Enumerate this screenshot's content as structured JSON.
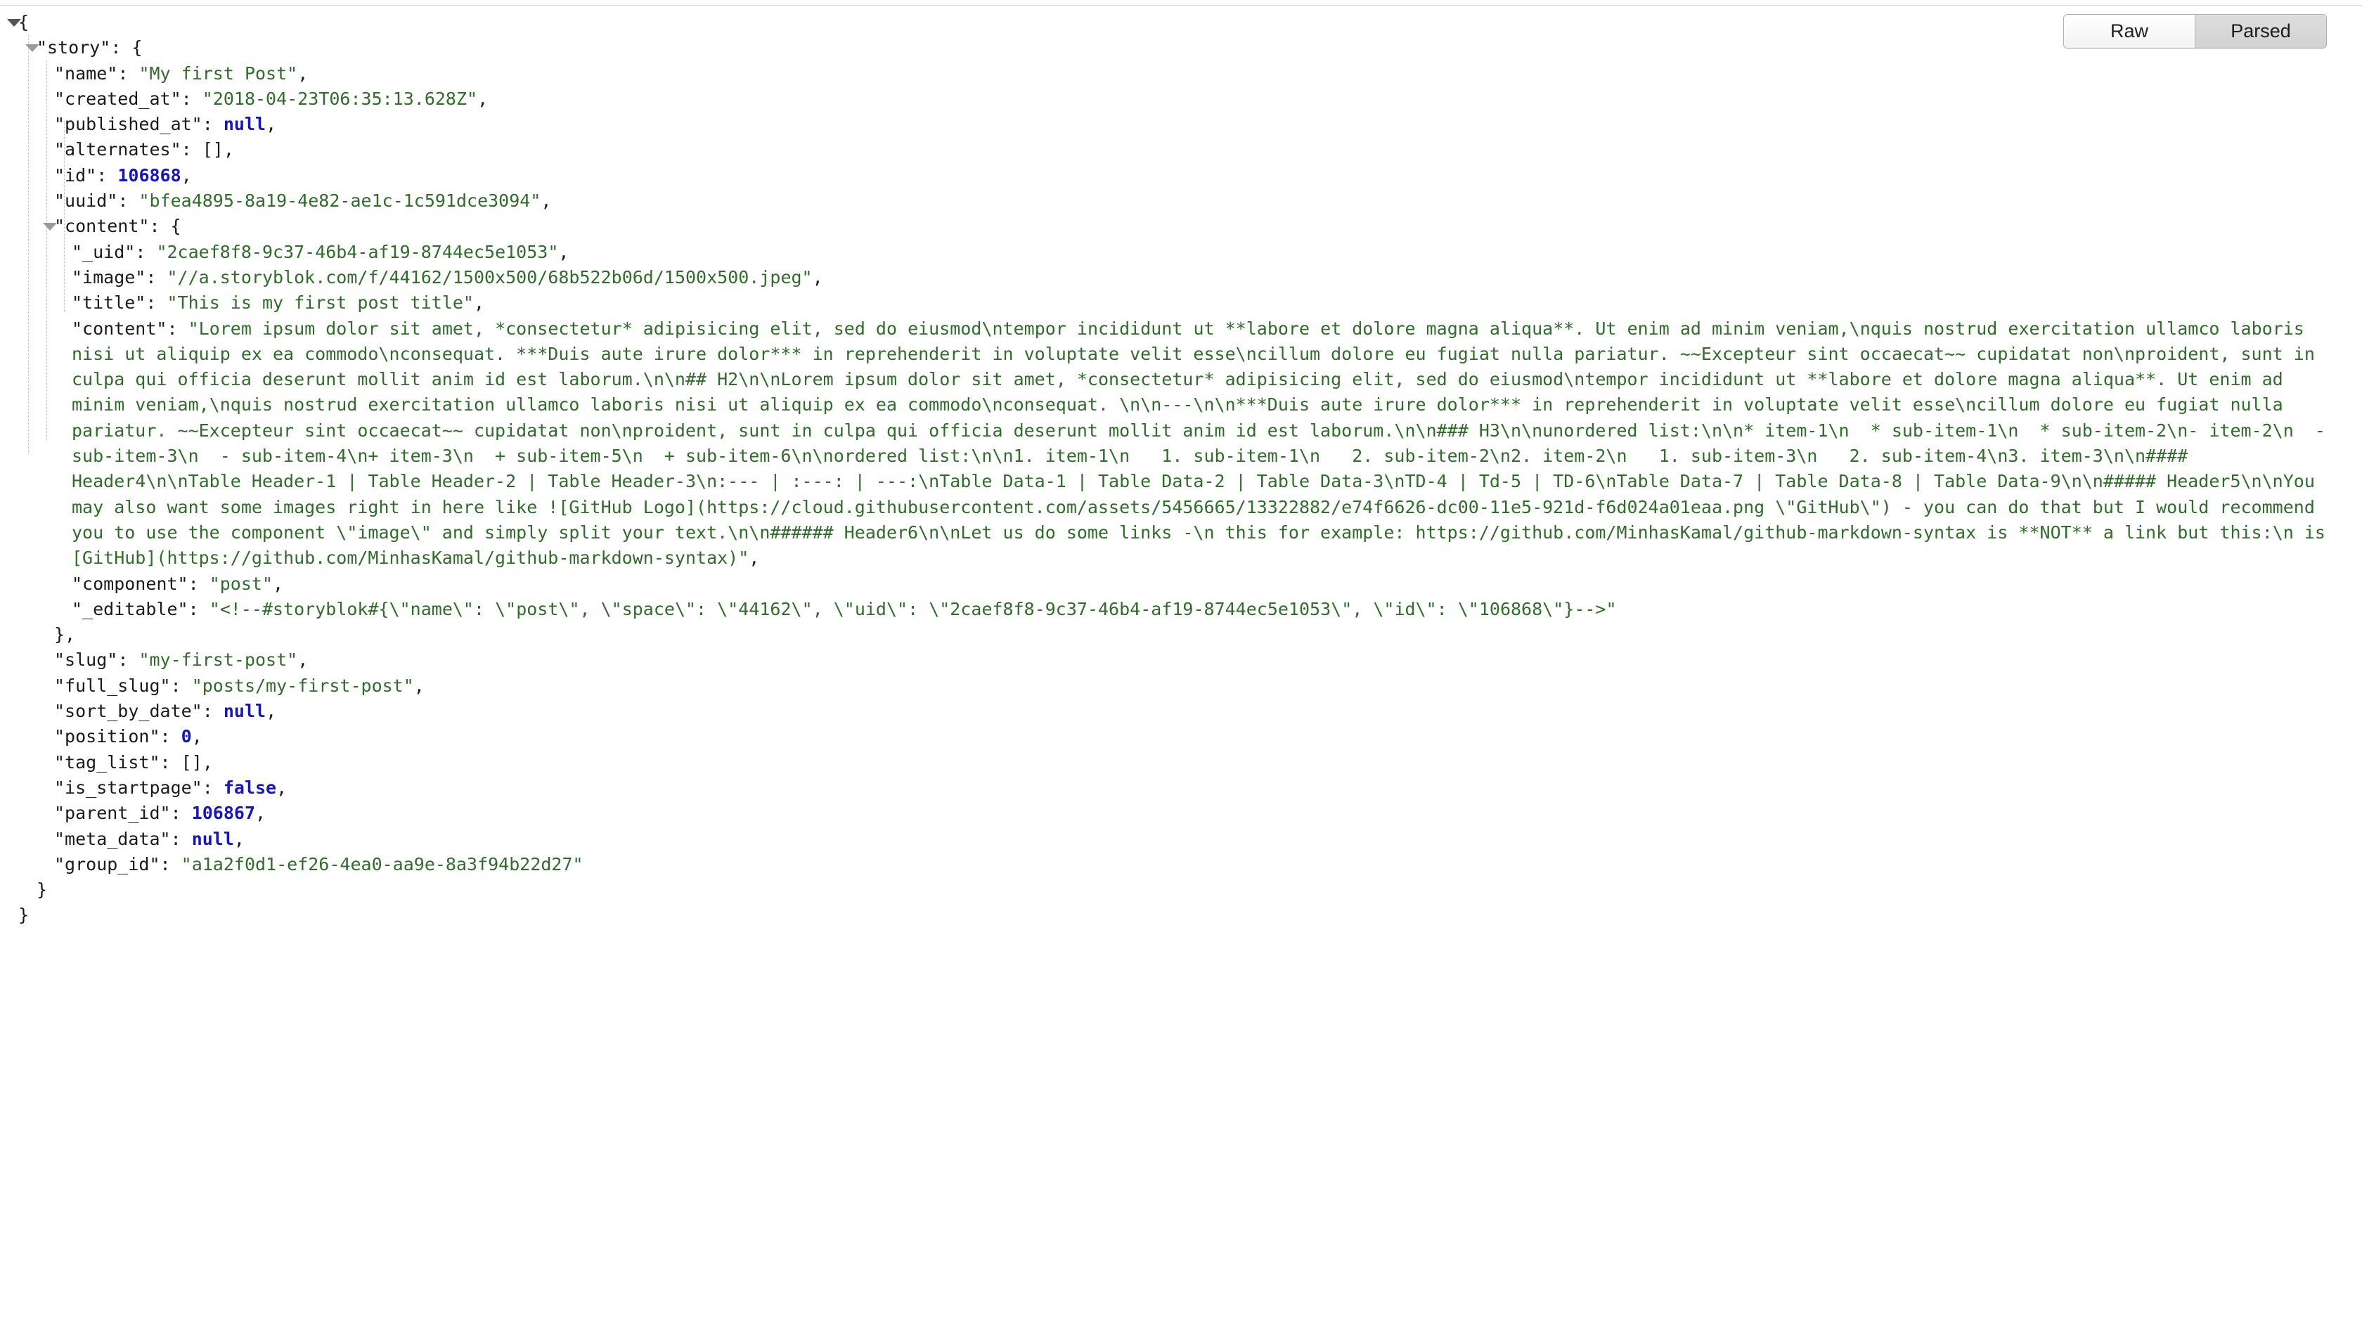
{
  "viewer": {
    "mode_tabs": [
      {
        "label": "Raw",
        "active": false
      },
      {
        "label": "Parsed",
        "active": true
      }
    ]
  },
  "json": {
    "root_open": "{",
    "root_close": "}",
    "story_key": "\"story\"",
    "story_open": "{",
    "story_close": "}",
    "content_key": "\"content\"",
    "content_open": "{",
    "content_close": "},",
    "colon": ":",
    "comma": ",",
    "fields": {
      "name": {
        "key": "\"name\"",
        "value": "\"My first Post\"",
        "type": "string"
      },
      "created_at": {
        "key": "\"created_at\"",
        "value": "\"2018-04-23T06:35:13.628Z\"",
        "type": "string"
      },
      "published_at": {
        "key": "\"published_at\"",
        "value": "null",
        "type": "literal"
      },
      "alternates": {
        "key": "\"alternates\"",
        "value": "[]",
        "type": "punct"
      },
      "id": {
        "key": "\"id\"",
        "value": "106868",
        "type": "number"
      },
      "uuid": {
        "key": "\"uuid\"",
        "value": "\"bfea4895-8a19-4e82-ae1c-1c591dce3094\"",
        "type": "string"
      },
      "_uid": {
        "key": "\"_uid\"",
        "value": "\"2caef8f8-9c37-46b4-af19-8744ec5e1053\"",
        "type": "string"
      },
      "image": {
        "key": "\"image\"",
        "value": "\"//a.storyblok.com/f/44162/1500x500/68b522b06d/1500x500.jpeg\"",
        "type": "string"
      },
      "title": {
        "key": "\"title\"",
        "value": "\"This is my first post title\"",
        "type": "string"
      },
      "content": {
        "key": "\"content\"",
        "value": "\"Lorem ipsum dolor sit amet, *consectetur* adipisicing elit, sed do eiusmod\\ntempor incididunt ut **labore et dolore magna aliqua**. Ut enim ad minim veniam,\\nquis nostrud exercitation ullamco laboris nisi ut aliquip ex ea commodo\\nconsequat. ***Duis aute irure dolor*** in reprehenderit in voluptate velit esse\\ncillum dolore eu fugiat nulla pariatur. ~~Excepteur sint occaecat~~ cupidatat non\\nproident, sunt in culpa qui officia deserunt mollit anim id est laborum.\\n\\n## H2\\n\\nLorem ipsum dolor sit amet, *consectetur* adipisicing elit, sed do eiusmod\\ntempor incididunt ut **labore et dolore magna aliqua**. Ut enim ad minim veniam,\\nquis nostrud exercitation ullamco laboris nisi ut aliquip ex ea commodo\\nconsequat. \\n\\n---\\n\\n***Duis aute irure dolor*** in reprehenderit in voluptate velit esse\\ncillum dolore eu fugiat nulla pariatur. ~~Excepteur sint occaecat~~ cupidatat non\\nproident, sunt in culpa qui officia deserunt mollit anim id est laborum.\\n\\n### H3\\n\\nunordered list:\\n\\n* item-1\\n  * sub-item-1\\n  * sub-item-2\\n- item-2\\n  - sub-item-3\\n  - sub-item-4\\n+ item-3\\n  + sub-item-5\\n  + sub-item-6\\n\\nordered list:\\n\\n1. item-1\\n   1. sub-item-1\\n   2. sub-item-2\\n2. item-2\\n   1. sub-item-3\\n   2. sub-item-4\\n3. item-3\\n\\n#### Header4\\n\\nTable Header-1 | Table Header-2 | Table Header-3\\n:--- | :---: | ---:\\nTable Data-1 | Table Data-2 | Table Data-3\\nTD-4 | Td-5 | TD-6\\nTable Data-7 | Table Data-8 | Table Data-9\\n\\n##### Header5\\n\\nYou may also want some images right in here like ![GitHub Logo](https://cloud.githubusercontent.com/assets/5456665/13322882/e74f6626-dc00-11e5-921d-f6d024a01eaa.png \\\"GitHub\\\") - you can do that but I would recommend you to use the component \\\"image\\\" and simply split your text.\\n\\n###### Header6\\n\\nLet us do some links -\\n this for example: https://github.com/MinhasKamal/github-markdown-syntax is **NOT** a link but this:\\n is [GitHub](https://github.com/MinhasKamal/github-markdown-syntax)\"",
        "type": "string"
      },
      "component": {
        "key": "\"component\"",
        "value": "\"post\"",
        "type": "string"
      },
      "_editable": {
        "key": "\"_editable\"",
        "value": "\"<!--#storyblok#{\\\"name\\\": \\\"post\\\", \\\"space\\\": \\\"44162\\\", \\\"uid\\\": \\\"2caef8f8-9c37-46b4-af19-8744ec5e1053\\\", \\\"id\\\": \\\"106868\\\"}-->\"",
        "type": "string"
      },
      "slug": {
        "key": "\"slug\"",
        "value": "\"my-first-post\"",
        "type": "string"
      },
      "full_slug": {
        "key": "\"full_slug\"",
        "value": "\"posts/my-first-post\"",
        "type": "string"
      },
      "sort_by_date": {
        "key": "\"sort_by_date\"",
        "value": "null",
        "type": "literal"
      },
      "position": {
        "key": "\"position\"",
        "value": "0",
        "type": "number"
      },
      "tag_list": {
        "key": "\"tag_list\"",
        "value": "[]",
        "type": "punct"
      },
      "is_startpage": {
        "key": "\"is_startpage\"",
        "value": "false",
        "type": "literal"
      },
      "parent_id": {
        "key": "\"parent_id\"",
        "value": "106867",
        "type": "number"
      },
      "meta_data": {
        "key": "\"meta_data\"",
        "value": "null",
        "type": "literal"
      },
      "group_id": {
        "key": "\"group_id\"",
        "value": "\"a1a2f0d1-ef26-4ea0-aa9e-8a3f94b22d27\"",
        "type": "string"
      }
    }
  }
}
